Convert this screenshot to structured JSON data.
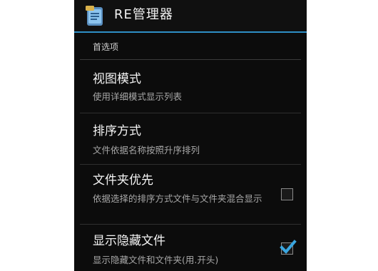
{
  "app": {
    "title": "RE管理器",
    "icon": "re-manager-app-icon"
  },
  "section": {
    "header": "首选项"
  },
  "preferences": [
    {
      "title": "视图模式",
      "summary": "使用详细模式显示列表",
      "has_checkbox": false
    },
    {
      "title": "排序方式",
      "summary": "文件依据名称按照升序排列",
      "has_checkbox": false
    },
    {
      "title": "文件夹优先",
      "summary": "依据选择的排序方式文件与文件夹混合显示",
      "has_checkbox": true,
      "checked": false
    },
    {
      "title": "显示隐藏文件",
      "summary": "显示隐藏文件和文件夹(用.开头)",
      "has_checkbox": true,
      "checked": true
    }
  ],
  "colors": {
    "accent": "#2e8fc6",
    "check": "#3aa6e0",
    "background": "#0c0c0c"
  }
}
